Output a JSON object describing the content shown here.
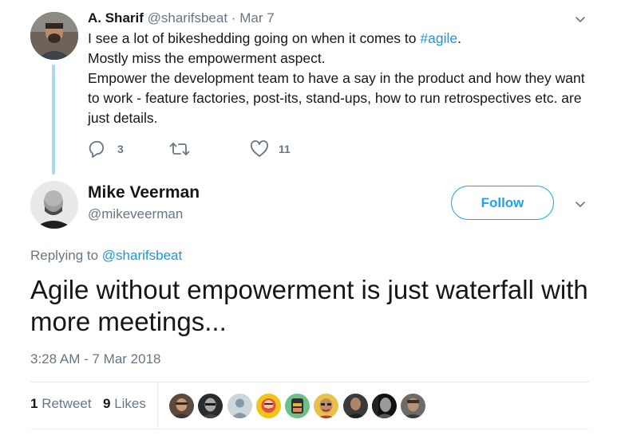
{
  "parent_tweet": {
    "name": "A. Sharif",
    "handle": "@sharifsbeat",
    "separator": "·",
    "date": "Mar 7",
    "text_line1_prefix": "I see a lot of bikeshedding going on when it comes to ",
    "hashtag": "#agile",
    "text_line1_suffix": ".",
    "text_line2": "Mostly miss the empowerment aspect.",
    "text_line3": "Empower the development team to have a say in the product and how they want to work - feature factories, post-its, stand-ups, how to run retrospectives etc. are just details.",
    "reply_count": "3",
    "retweet_count": "",
    "like_count": "11"
  },
  "main_tweet": {
    "name": "Mike Veerman",
    "handle": "@mikeveerman",
    "follow_label": "Follow",
    "replying_prefix": "Replying to ",
    "replying_mention": "@sharifsbeat",
    "text": "Agile without empowerment is just waterfall with more meetings...",
    "timestamp": "3:28 AM - 7 Mar 2018",
    "retweets_count": "1",
    "retweets_label": "Retweet",
    "likes_count": "9",
    "likes_label": "Likes"
  },
  "colors": {
    "link": "#1b95e0",
    "accent": "#1da1f2",
    "thread_line": "#a8daf4",
    "muted": "#657786"
  },
  "likers_count": 9
}
